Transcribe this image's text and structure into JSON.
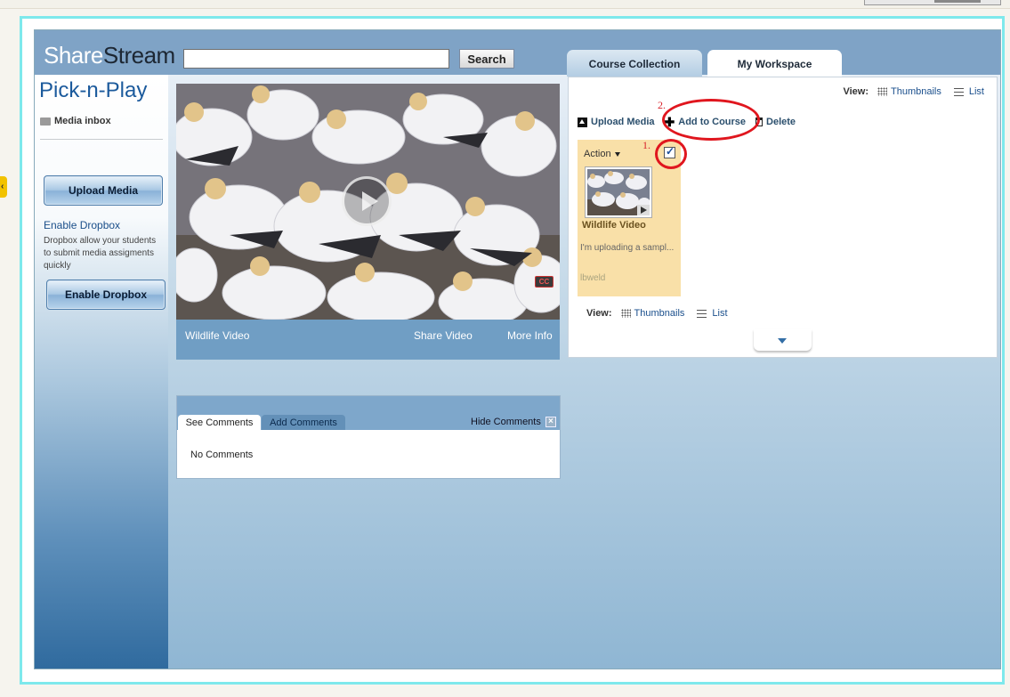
{
  "header": {
    "logo_share": "Share",
    "logo_stream": "Stream",
    "search_value": "",
    "search_button": "Search"
  },
  "sidebar": {
    "app_title": "Pick-n-Play",
    "media_inbox": "Media inbox",
    "upload_media_button": "Upload Media",
    "enable_dropbox_link": "Enable Dropbox",
    "dropbox_description": "Dropbox allow your students to submit media assigments quickly",
    "enable_dropbox_button": "Enable Dropbox"
  },
  "player": {
    "title": "Wildlife Video",
    "share_label": "Share Video",
    "more_info_label": "More Info",
    "cc_label": "CC"
  },
  "comments": {
    "see_tab": "See Comments",
    "add_tab": "Add Comments",
    "hide_label": "Hide Comments",
    "hide_icon": "×",
    "empty_text": "No Comments"
  },
  "workspace": {
    "tabs": [
      {
        "label": "Course Collection"
      },
      {
        "label": "My Workspace"
      }
    ],
    "view_label": "View:",
    "thumbnails_label": "Thumbnails",
    "list_label": "List",
    "actions": {
      "upload": "Upload Media",
      "add_to_course": "Add to Course",
      "delete": "Delete"
    },
    "card": {
      "action_label": "Action",
      "title": "Wildlife Video",
      "description": "I'm uploading a sampl...",
      "owner": "lbweld",
      "selected": true
    }
  },
  "annotations": {
    "step1": "1.",
    "step2": "2.",
    "ring_color": "#e0161e"
  },
  "icons": [
    "inbox-icon",
    "upload-icon",
    "plus-icon",
    "trash-icon",
    "grid-icon",
    "list-icon",
    "play-icon",
    "close-icon",
    "chevron-down-icon"
  ]
}
